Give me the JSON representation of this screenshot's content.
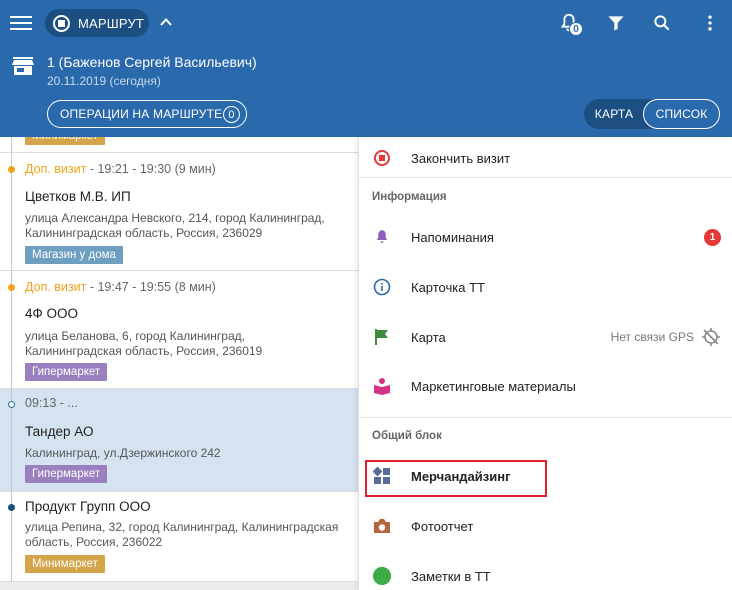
{
  "header": {
    "route_label": "МАРШРУТ",
    "notification_count": "0",
    "route_title": "1 (Баженов Сергей Васильевич)",
    "route_date": "20.11.2019 (сегодня)",
    "ops_label": "ОПЕРАЦИИ НА МАРШРУТЕ",
    "ops_count": "0",
    "map_label": "КАРТА",
    "list_label": "СПИСОК",
    "colors": {
      "primary": "#2a6aac",
      "primary_dark": "#1d4e82"
    }
  },
  "list": {
    "top_tag": "Минимаркет",
    "cards": [
      {
        "visit_type": "Доп. визит",
        "time": " - 19:21 - 19:30 (9 мин)",
        "title": "Цветков М.В. ИП",
        "address": "улица Александра Невского, 214, город Калининград, Калининградская область, Россия, 236029",
        "tag": "Магазин у дома"
      },
      {
        "visit_type": "Доп. визит",
        "time": " - 19:47 - 19:55 (8 мин)",
        "title": "4Ф ООО",
        "address": "улица Беланова, 6, город Калининград, Калининградская область, Россия, 236019",
        "tag": "Гипермаркет"
      },
      {
        "time": "09:13 - ...",
        "title": "Тандер АО",
        "address": "Калининград, ул.Дзержинского 242",
        "tag": "Гипермаркет"
      },
      {
        "title": "Продукт Групп ООО",
        "address": "улица Репина, 32, город Калининград, Калининградская область, Россия, 236022",
        "tag": "Минимаркет"
      }
    ]
  },
  "menu": {
    "finish_visit": "Закончить визит",
    "section_info": "Информация",
    "reminders": "Напоминания",
    "reminders_badge": "1",
    "card_tt": "Карточка ТТ",
    "map": "Карта",
    "gps_status": "Нет связи GPS",
    "marketing": "Маркетинговые материалы",
    "section_common": "Общий блок",
    "merch": "Мерчандайзинг",
    "photo": "Фотоотчет",
    "notes": "Заметки в ТТ"
  }
}
